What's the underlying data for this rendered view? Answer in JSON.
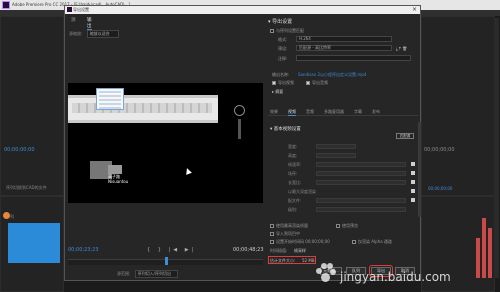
{
  "app": {
    "window_title": "Adobe Premiere Pro CC 2017 - [E:\\baidu\\cad\\...AutoCAD\\...]",
    "bg_timecode_left": "00;00;00;00",
    "bg_timecode_mid": "00;00;00;00",
    "bg_label_1": "序列切换到CAD的文件",
    "bg_label_2": "序列"
  },
  "dialog": {
    "title": "导出设置",
    "tabs": [
      "源",
      "输出"
    ],
    "active_tab": "输出",
    "source_scaling_label": "源缩放:",
    "source_scaling_value": "缩放以适合",
    "caption_cn": "高子路",
    "caption_en": "Nisuantou",
    "timecode_left": "00;00;23;23",
    "timecode_right": "00;00;48;23",
    "transport_icons": [
      "{",
      "}",
      "|◀",
      "▶|"
    ],
    "source_range_label": "源范围:",
    "source_range_value": "序列切入/序列切出"
  },
  "export": {
    "header": "导出设置",
    "match_sequence": "与序列设置匹配",
    "format_label": "格式:",
    "format_value": "H.264",
    "preset_label": "预设:",
    "preset_value": "匹配源 - 高比特率",
    "comments_label": "注释:",
    "output_name_label": "输出名称:",
    "output_name_value": "Sandisan 2以小程序自定义设置.mp4",
    "export_video": "导出视频",
    "export_audio": "导出音频",
    "summary_label": "摘要",
    "tabs": [
      "效果",
      "视频",
      "音频",
      "多路复用器",
      "字幕",
      "发布"
    ],
    "active_tab": "视频",
    "section": "基本视频设置",
    "match_source_btn": "匹配源",
    "video_rows": [
      "宽度:",
      "高度:",
      "帧速率:",
      "场序:",
      "长宽比:",
      "以最大深度渲染",
      "配文件:",
      "级别:"
    ],
    "max_quality": "使用最高渲染质量",
    "use_previews": "使用预览",
    "import_project": "导入到项目中",
    "set_start_tc": "设置开始时间码",
    "start_tc_value": "00;00;00;00",
    "alpha_only": "仅渲染 Alpha 通道",
    "time_interp_label": "时间插值:",
    "time_interp_value": "帧采样",
    "estimated_size_label": "估计文件大小:",
    "estimated_size_value": "52 MB",
    "metadata_btn": "元数据...",
    "queue_btn": "队列",
    "export_btn": "导出",
    "cancel_btn": "取消"
  },
  "watermark": {
    "text": "jingyan.baidu.com"
  }
}
